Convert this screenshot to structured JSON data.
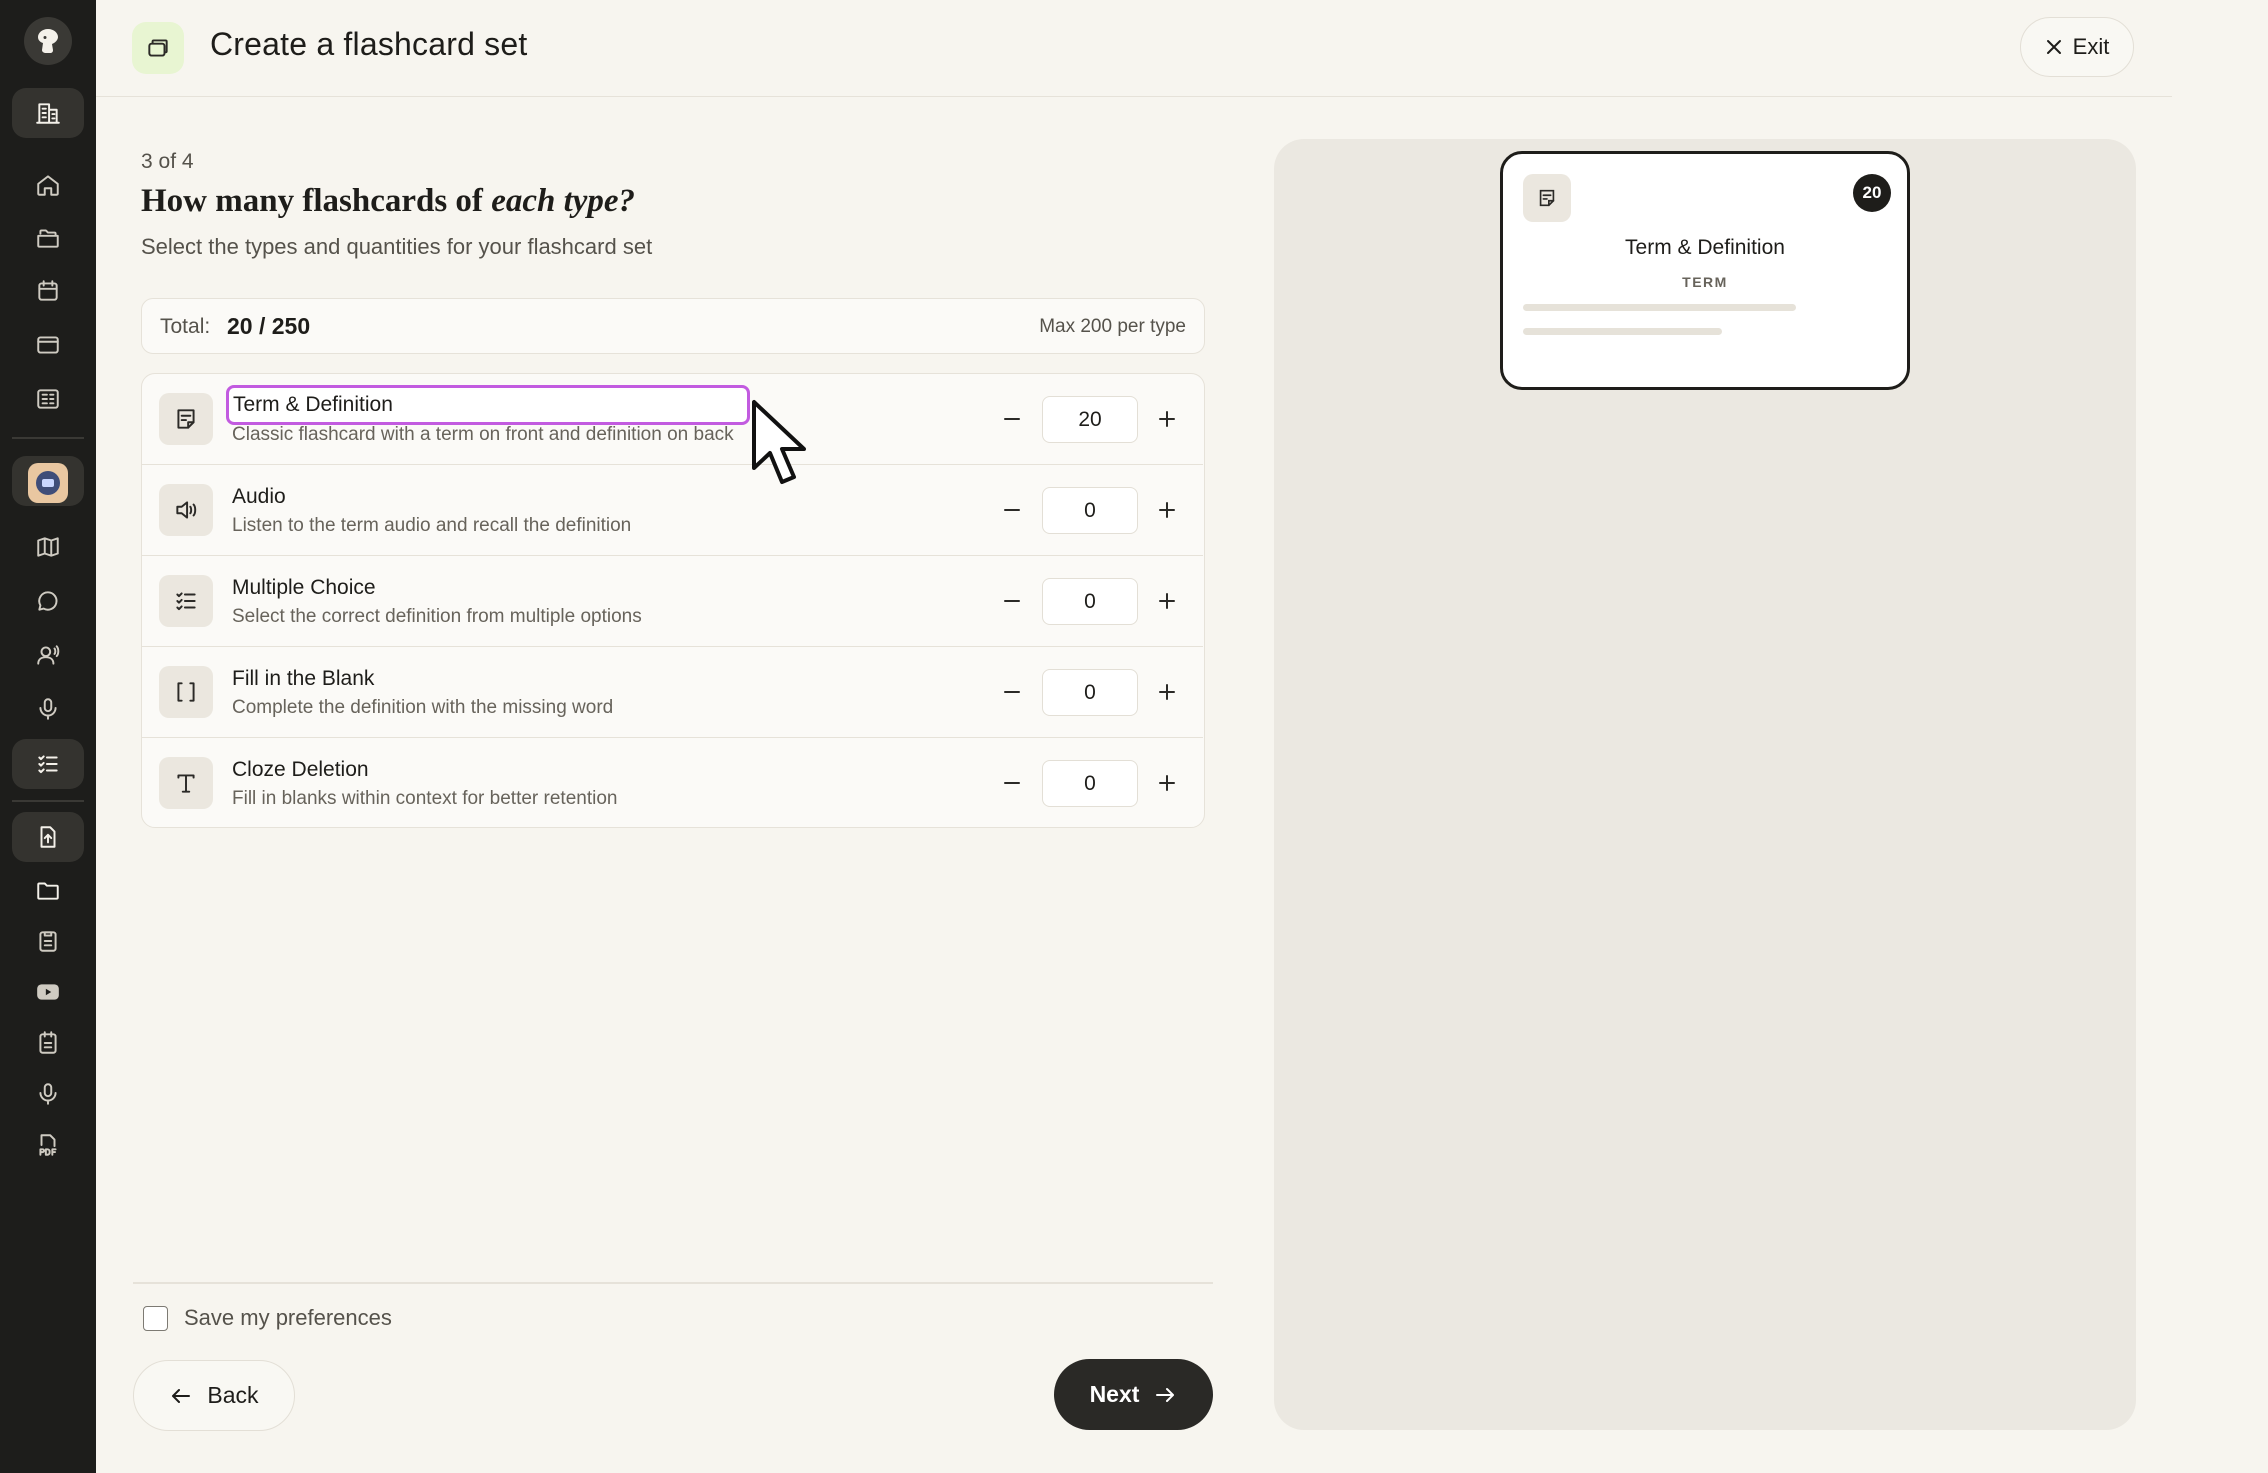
{
  "header": {
    "title": "Create a flashcard set",
    "exit_label": "Exit"
  },
  "step": {
    "indicator": "3 of 4",
    "question_plain": "How many flashcards of ",
    "question_emphasis": "each type?",
    "subtitle": "Select the types and quantities for your flashcard set"
  },
  "total": {
    "label": "Total:",
    "value": "20 / 250",
    "max_note": "Max 200 per type"
  },
  "types": [
    {
      "name": "Term & Definition",
      "description": "Classic flashcard with a term on front and definition on back",
      "quantity": "20",
      "icon": "note-icon"
    },
    {
      "name": "Audio",
      "description": "Listen to the term audio and recall the definition",
      "quantity": "0",
      "icon": "speaker-icon"
    },
    {
      "name": "Multiple Choice",
      "description": "Select the correct definition from multiple options",
      "quantity": "0",
      "icon": "checklist-icon"
    },
    {
      "name": "Fill in the Blank",
      "description": "Complete the definition with the missing word",
      "quantity": "0",
      "icon": "brackets-icon"
    },
    {
      "name": "Cloze Deletion",
      "description": "Fill in blanks within context for better retention",
      "quantity": "0",
      "icon": "text-icon"
    }
  ],
  "footer": {
    "save_preferences_label": "Save my preferences",
    "save_preferences_checked": false,
    "back_label": "Back",
    "next_label": "Next"
  },
  "preview": {
    "card_title": "Term & Definition",
    "card_subtitle": "TERM",
    "card_count": "20"
  },
  "sidebar": {
    "items": [
      "logo-icon",
      "building-icon",
      "home-icon",
      "folders-icon",
      "calendar-icon",
      "window-icon",
      "library-icon",
      "app-icon",
      "map-icon",
      "chat-icon",
      "voice-agent-icon",
      "microphone-icon",
      "checklist-icon",
      "upload-file-icon",
      "folder-icon",
      "clipboard-icon",
      "youtube-icon",
      "notes-icon",
      "microphone-icon",
      "pdf-icon"
    ]
  },
  "colors": {
    "accent_focus": "#c25be0",
    "sidebar_bg": "#1d1d1b",
    "primary_button": "#2a2926",
    "header_icon_bg": "#e8f5d2"
  }
}
